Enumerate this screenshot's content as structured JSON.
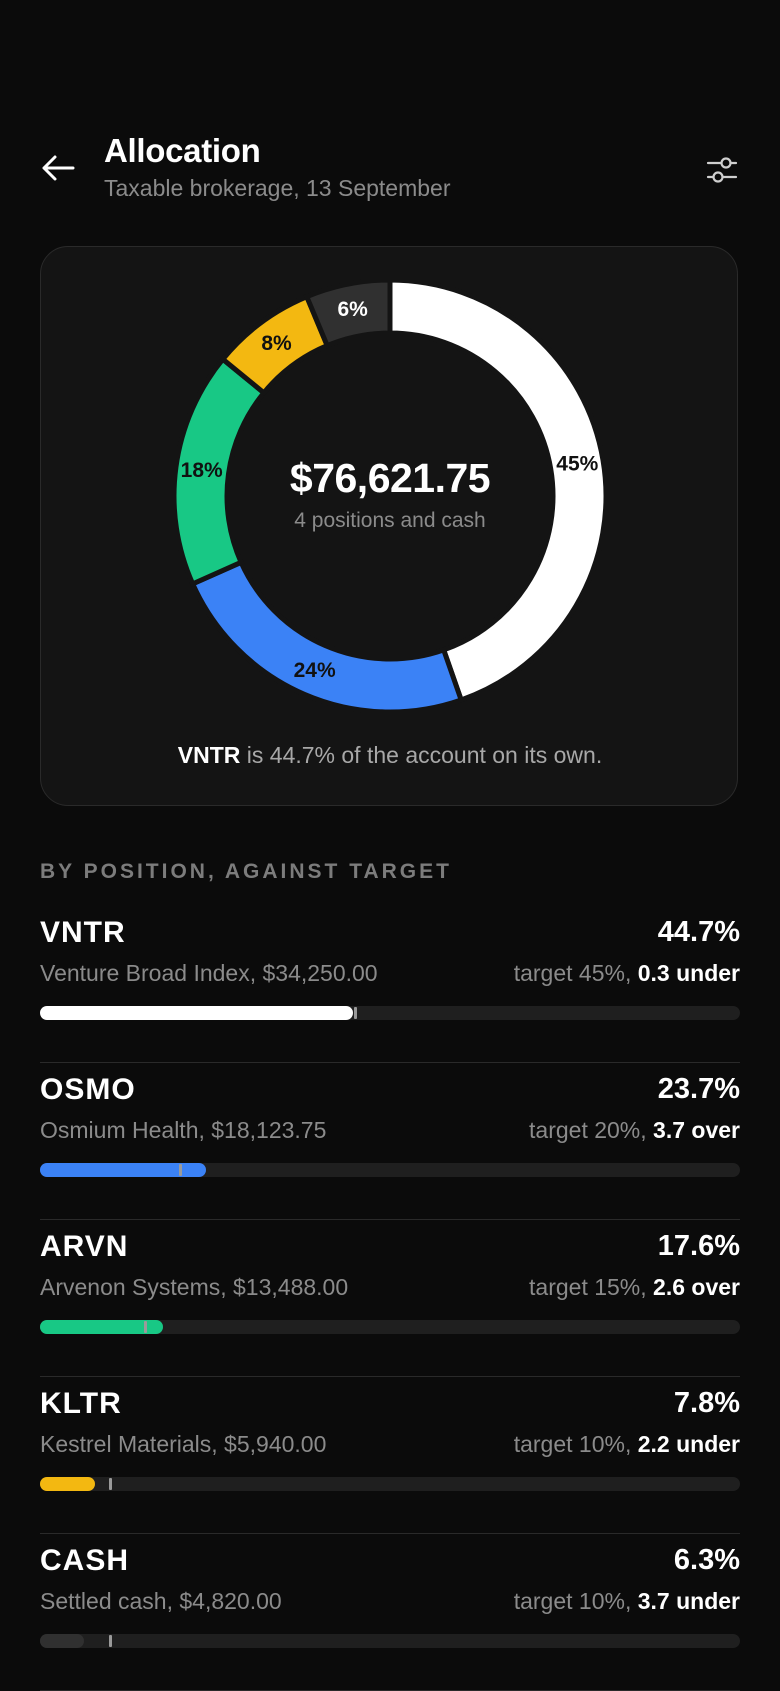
{
  "header": {
    "title": "Allocation",
    "subtitle": "Taxable brokerage, 13 September",
    "back_icon": "arrow-left-icon",
    "filter_icon": "sliders-icon"
  },
  "summary": {
    "total": "$76,621.75",
    "caption": "4 positions and cash",
    "note_ticker": "VNTR",
    "note_text": " is 44.7% of the account on its own."
  },
  "chart_data": {
    "type": "pie",
    "donut": true,
    "slices": [
      {
        "label": "VNTR",
        "value": 44.7,
        "display": "45%",
        "color": "#ffffff",
        "text_color": "#111111"
      },
      {
        "label": "OSMO",
        "value": 23.7,
        "display": "24%",
        "color": "#3b82f6",
        "text_color": "#111111"
      },
      {
        "label": "ARVN",
        "value": 17.6,
        "display": "18%",
        "color": "#18c885",
        "text_color": "#111111"
      },
      {
        "label": "KLTR",
        "value": 7.8,
        "display": "8%",
        "color": "#f3b811",
        "text_color": "#111111"
      },
      {
        "label": "CASH",
        "value": 6.3,
        "display": "6%",
        "color": "#303030",
        "text_color": "#ffffff"
      }
    ]
  },
  "section_label": "BY POSITION, AGAINST TARGET",
  "positions": [
    {
      "ticker": "VNTR",
      "pct": "44.7%",
      "desc": "Venture Broad Index, $34,250.00",
      "target_prefix": "target 45%, ",
      "target_delta": "0.3 under",
      "actual": 44.7,
      "target": 45,
      "color": "#ffffff"
    },
    {
      "ticker": "OSMO",
      "pct": "23.7%",
      "desc": "Osmium Health, $18,123.75",
      "target_prefix": "target 20%, ",
      "target_delta": "3.7 over",
      "actual": 23.7,
      "target": 20,
      "color": "#3b82f6"
    },
    {
      "ticker": "ARVN",
      "pct": "17.6%",
      "desc": "Arvenon Systems, $13,488.00",
      "target_prefix": "target 15%, ",
      "target_delta": "2.6 over",
      "actual": 17.6,
      "target": 15,
      "color": "#18c885"
    },
    {
      "ticker": "KLTR",
      "pct": "7.8%",
      "desc": "Kestrel Materials, $5,940.00",
      "target_prefix": "target 10%, ",
      "target_delta": "2.2 under",
      "actual": 7.8,
      "target": 10,
      "color": "#f3b811"
    },
    {
      "ticker": "CASH",
      "pct": "6.3%",
      "desc": "Settled cash, $4,820.00",
      "target_prefix": "target 10%, ",
      "target_delta": "3.7 under",
      "actual": 6.3,
      "target": 10,
      "color": "#303030"
    }
  ]
}
